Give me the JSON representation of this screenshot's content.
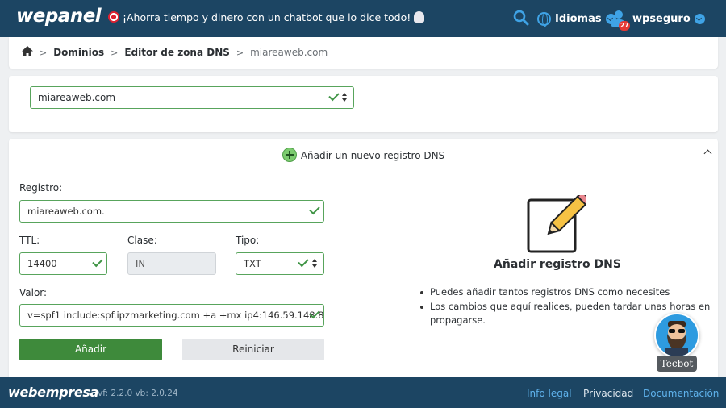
{
  "header": {
    "logo": "wepanel",
    "promo": "¡Ahorra tiempo y dinero con un chatbot que lo dice todo!",
    "language_label": "Idiomas",
    "username": "wpseguro",
    "notification_count": "27"
  },
  "breadcrumb": {
    "items": [
      "Dominios",
      "Editor de zona DNS"
    ],
    "current": "miareaweb.com"
  },
  "domain_select": {
    "value": "miareaweb.com"
  },
  "form": {
    "title": "Añadir un nuevo registro DNS",
    "registro_label": "Registro:",
    "registro_value": "miareaweb.com.",
    "ttl_label": "TTL:",
    "ttl_value": "14400",
    "clase_label": "Clase:",
    "clase_value": "IN",
    "tipo_label": "Tipo:",
    "tipo_value": "TXT",
    "valor_label": "Valor:",
    "valor_value": "v=spf1 include:spf.ipzmarketing.com +a +mx ip4:146.59.148.8",
    "submit_label": "Añadir",
    "reset_label": "Reiniciar"
  },
  "info": {
    "title": "Añadir registro DNS",
    "tips": [
      "Puedes añadir tantos registros DNS como necesites",
      "Los cambios que aquí realices, pueden tardar unas horas en propagarse."
    ]
  },
  "footer": {
    "logo": "webempresa",
    "version": "vf: 2.2.0  vb: 2.0.24",
    "links": [
      "Info legal",
      "Privacidad",
      "Documentación"
    ]
  },
  "chatbot": {
    "label": "Tecbot"
  },
  "colors": {
    "navbar": "#1c4563",
    "accent_blue": "#3fa3e6",
    "valid_green": "#58a45c",
    "primary_button": "#3e8a3b",
    "footer_link": "#5fb2ec"
  }
}
